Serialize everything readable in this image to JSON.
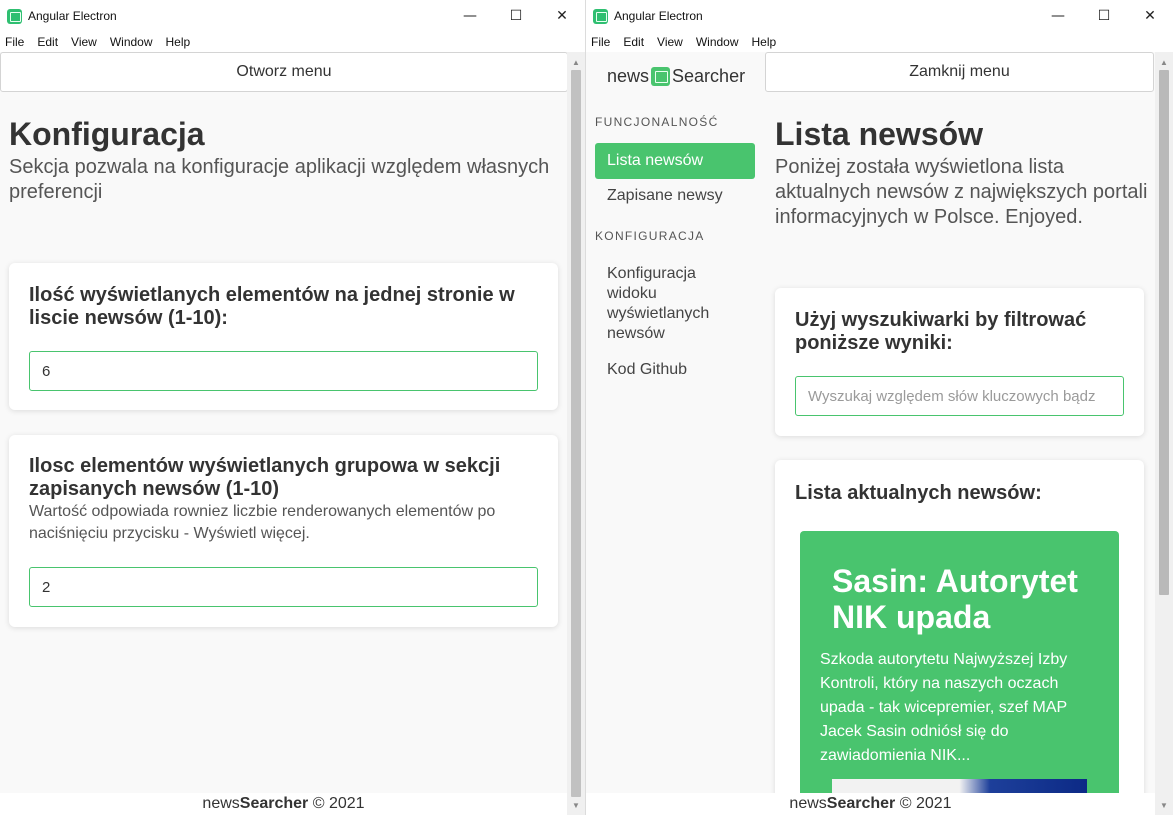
{
  "left_window": {
    "title": "Angular Electron",
    "menu": [
      "File",
      "Edit",
      "View",
      "Window",
      "Help"
    ],
    "toggle_label": "Otworz menu",
    "heading": "Konfiguracja",
    "subtitle": "Sekcja pozwala na konfiguracje aplikacji względem własnych preferencji",
    "card1": {
      "title": "Ilość wyświetlanych elementów na jednej stronie w liscie newsów (1-10):",
      "value": "6"
    },
    "card2": {
      "title": "Ilosc elementów wyświetlanych grupowa w sekcji zapisanych newsów (1-10)",
      "hint": "Wartość odpowiada rowniez liczbie renderowanych elementów po naciśnięciu przycisku - Wyświetl więcej.",
      "value": "2"
    },
    "footer": {
      "prefix": "news",
      "brand": "Searcher",
      "suffix": "© 2021"
    }
  },
  "right_window": {
    "title": "Angular Electron",
    "menu": [
      "File",
      "Edit",
      "View",
      "Window",
      "Help"
    ],
    "toggle_label": "Zamknij menu",
    "logo": {
      "prefix": "news",
      "brand": "Searcher"
    },
    "sidebar": {
      "section1": "FUNCJONALNOŚĆ",
      "item_news_list": "Lista newsów",
      "item_saved": "Zapisane newsy",
      "section2": "KONFIGURACJA",
      "item_config": "Konfiguracja widoku wyświetlanych newsów",
      "item_github": "Kod Github"
    },
    "heading": "Lista newsów",
    "subtitle": "Poniżej została wyświetlona lista aktualnych newsów z największych portali informacyjnych w Polsce. Enjoyed.",
    "search_card": {
      "title": "Użyj wyszukiwarki by filtrować poniższe wyniki:",
      "placeholder": "Wyszukaj względem słów kluczowych bądz"
    },
    "list_card": {
      "title": "Lista aktualnych newsów:",
      "news_title": "Sasin: Autorytet NIK upada",
      "news_excerpt": "Szkoda autorytetu Najwyższej Izby Kontroli, który na naszych oczach upada - tak wicepremier, szef MAP Jacek Sasin odniósł się do zawiadomienia NIK..."
    },
    "footer": {
      "prefix": "news",
      "brand": "Searcher",
      "suffix": "© 2021"
    }
  },
  "colors": {
    "accent": "#49c46e",
    "background": "#f9f9f9"
  }
}
